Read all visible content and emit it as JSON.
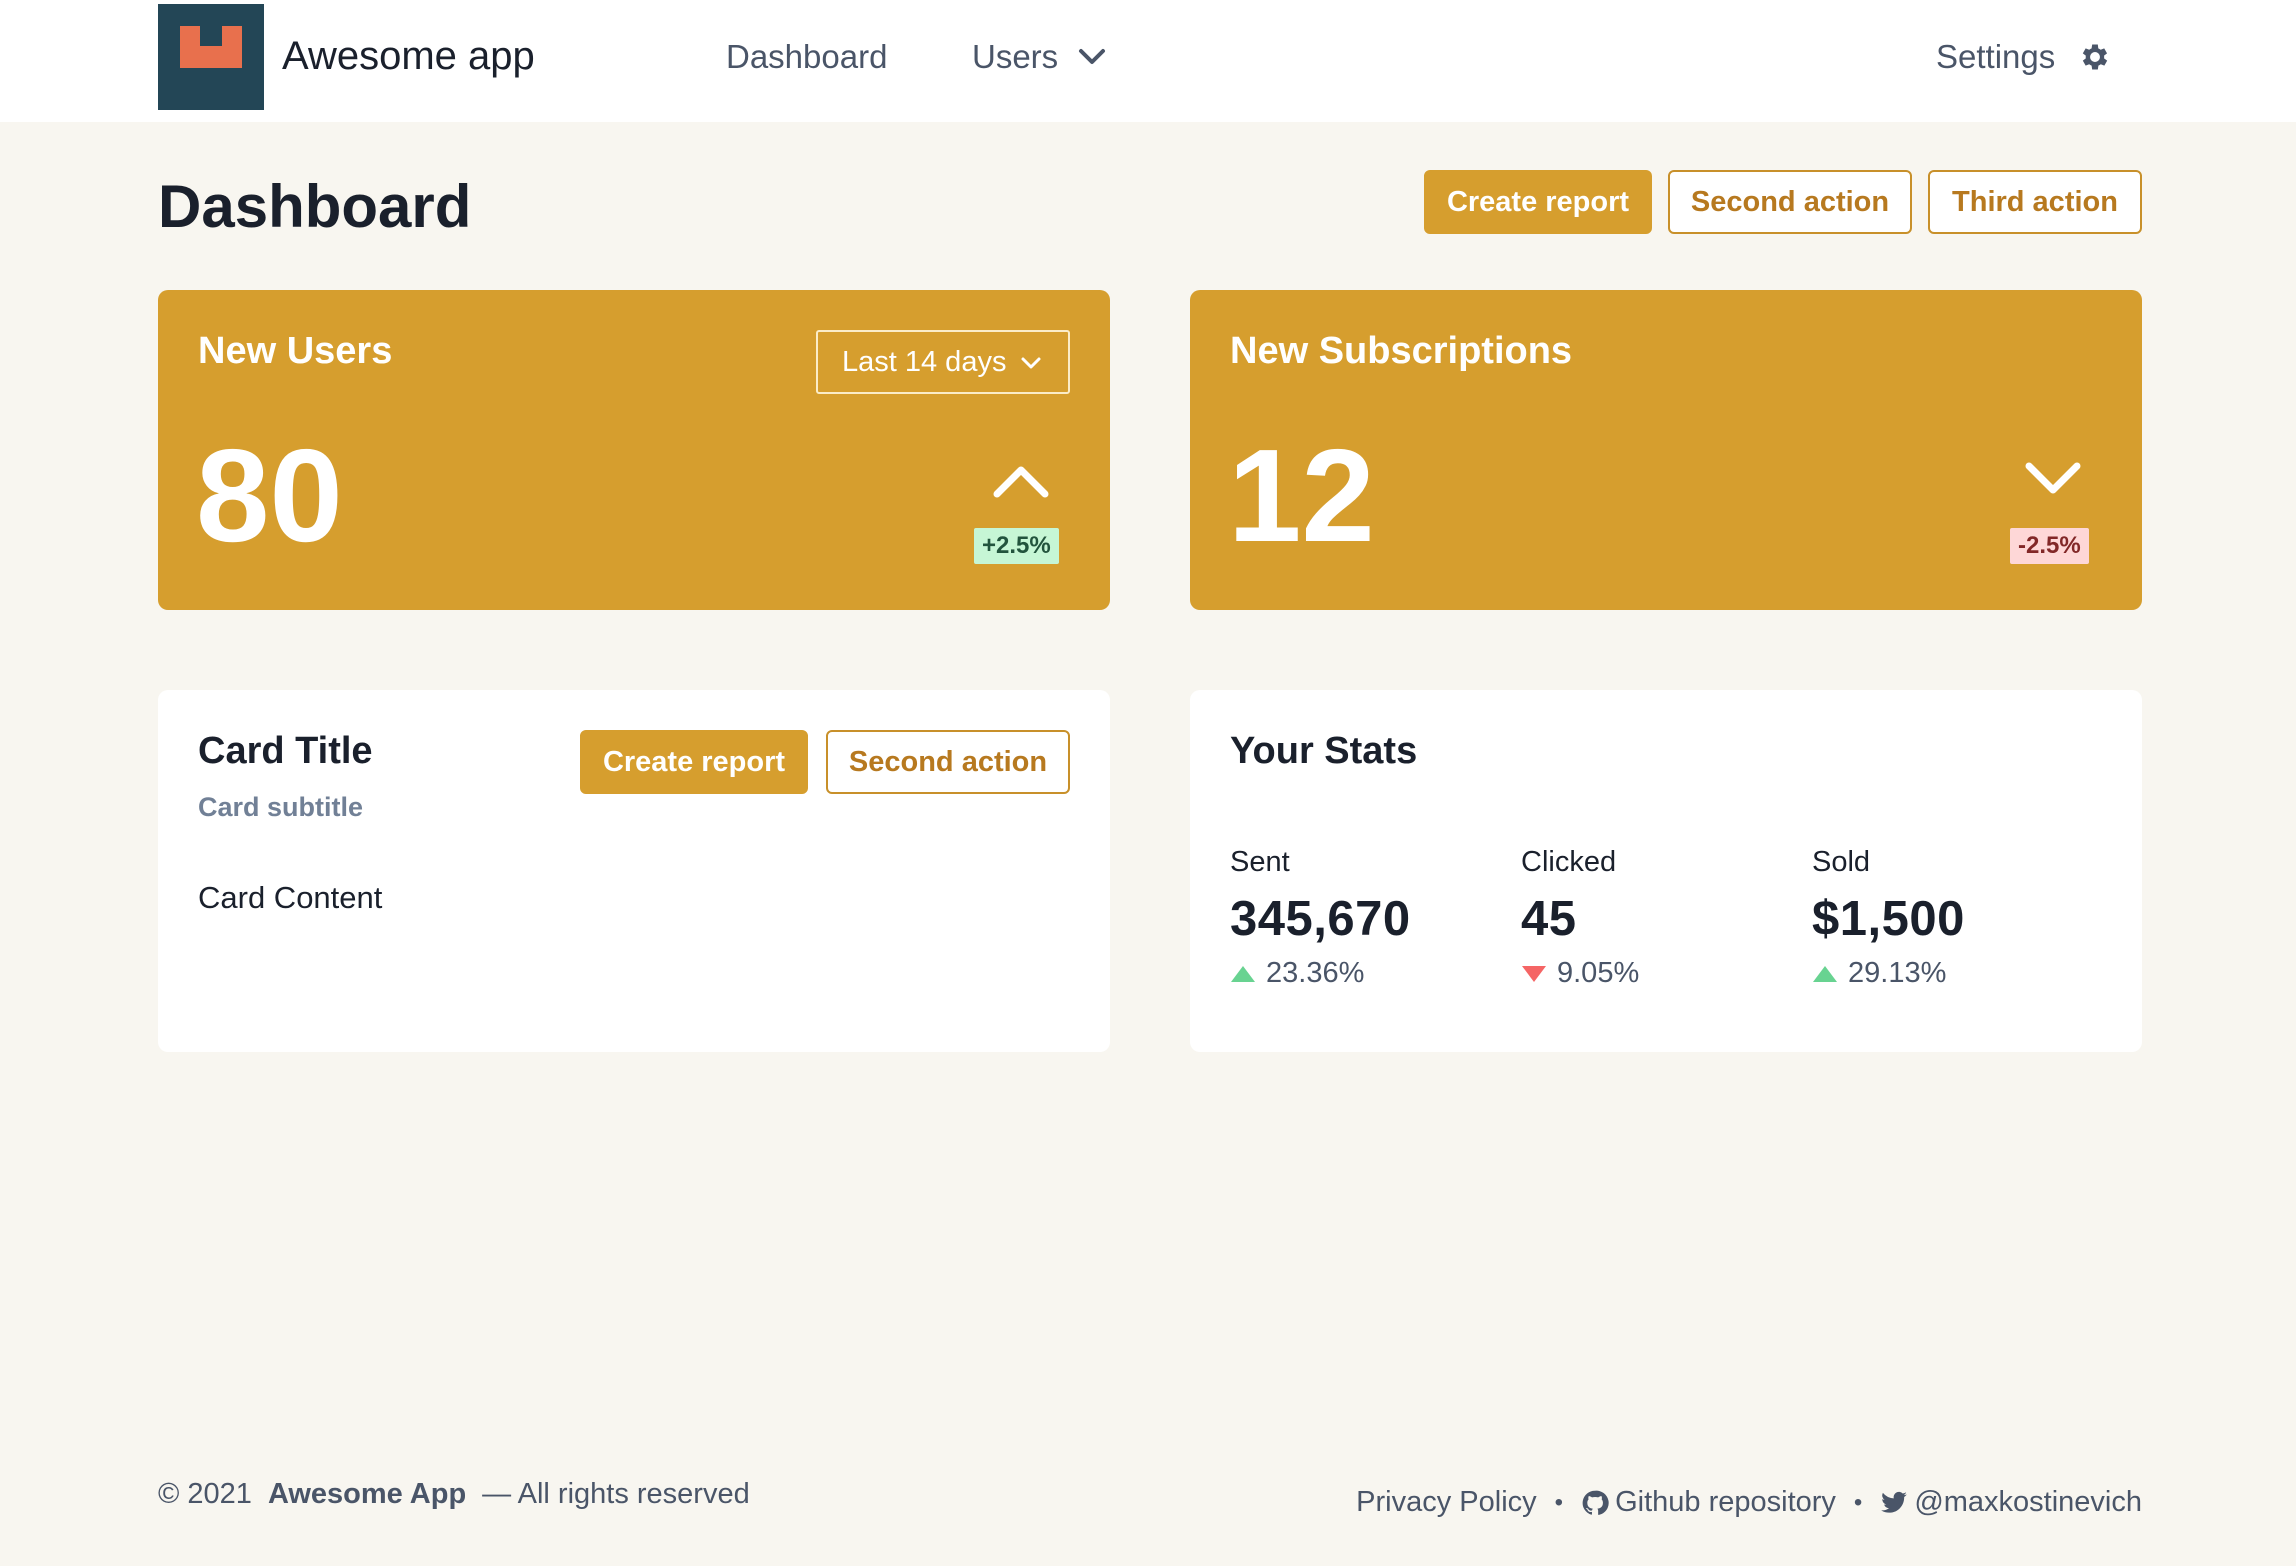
{
  "header": {
    "app_name": "Awesome app",
    "nav": {
      "dashboard": "Dashboard",
      "users": "Users",
      "settings": "Settings"
    }
  },
  "page": {
    "title": "Dashboard",
    "actions": {
      "primary": "Create report",
      "second": "Second action",
      "third": "Third action"
    }
  },
  "stat_cards": [
    {
      "title": "New Users",
      "value": "80",
      "range": "Last 14 days",
      "trend": "up",
      "change": "+2.5%"
    },
    {
      "title": "New Subscriptions",
      "value": "12",
      "trend": "down",
      "change": "-2.5%"
    }
  ],
  "card": {
    "title": "Card Title",
    "subtitle": "Card subtitle",
    "content": "Card Content",
    "actions": {
      "primary": "Create report",
      "second": "Second action"
    }
  },
  "stats": {
    "title": "Your Stats",
    "items": [
      {
        "label": "Sent",
        "value": "345,670",
        "change": "23.36%",
        "direction": "up"
      },
      {
        "label": "Clicked",
        "value": "45",
        "change": "9.05%",
        "direction": "down"
      },
      {
        "label": "Sold",
        "value": "$1,500",
        "change": "29.13%",
        "direction": "up"
      }
    ]
  },
  "footer": {
    "copyright": "© 2021",
    "brand": "Awesome App",
    "rights": "— All rights reserved",
    "links": {
      "privacy": "Privacy Policy",
      "github": "Github repository",
      "twitter": "@maxkostinevich"
    }
  },
  "colors": {
    "accent": "#d69e2e",
    "background": "#f8f6f0",
    "logo_bg": "#234656",
    "logo_mark": "#e8704d",
    "trend_up": "#68d391",
    "trend_down": "#f56565"
  },
  "icons": [
    "logo-icon",
    "chevron-down-icon",
    "gear-icon",
    "chevron-up-icon",
    "triangle-up-icon",
    "triangle-down-icon",
    "github-icon",
    "twitter-icon"
  ]
}
